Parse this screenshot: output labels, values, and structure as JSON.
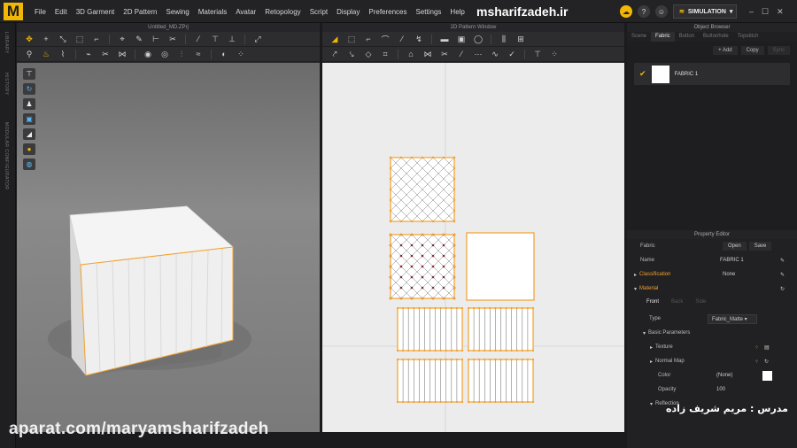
{
  "app": {
    "logo_letter": "M",
    "brand": "msharifzadeh.ir"
  },
  "menu": [
    "File",
    "Edit",
    "3D Garment",
    "2D Pattern",
    "Sewing",
    "Materials",
    "Avatar",
    "Retopology",
    "Script",
    "Display",
    "Preferences",
    "Settings",
    "Help"
  ],
  "topbar": {
    "simulation_label": "SIMULATION"
  },
  "left_strip": {
    "labels": [
      "LIBRARY",
      "HISTORY",
      "MODULAR CONFIGURATOR"
    ]
  },
  "window3d": {
    "title": "Untitled_MD.ZPrj"
  },
  "window2d": {
    "title": "2D Pattern Window"
  },
  "object_browser": {
    "title": "Object Browser",
    "tabs": [
      "Scene",
      "Fabric",
      "Button",
      "Buttonhole",
      "Topstitch"
    ],
    "active_tab": "Fabric",
    "add_label": "+ Add",
    "copy_label": "Copy",
    "sync_label": "Sync",
    "fabric_name": "FABRIC 1"
  },
  "property_editor": {
    "title": "Property Editor",
    "fabric_label": "Fabric",
    "open_label": "Open",
    "save_label": "Save",
    "name_label": "Name",
    "name_value": "FABRIC 1",
    "classification_label": "Classification",
    "classification_value": "None",
    "material_label": "Material",
    "subtabs": [
      "Front",
      "Back",
      "Side"
    ],
    "type_label": "Type",
    "type_value": "Fabric_Matte",
    "basic_params_label": "Basic Parameters",
    "texture_label": "Texture",
    "normal_map_label": "Normal Map",
    "color_label": "Color",
    "color_value": "(None)",
    "opacity_label": "Opacity",
    "opacity_value": "100",
    "reflection_label": "Reflection"
  },
  "overlay": {
    "watermark": "aparat.com/maryamsharifzadeh",
    "persian": "مدرس : مریم شریف زاده"
  },
  "colors": {
    "accent": "#f2b705",
    "outline": "#f2a02a",
    "dot_purple": "#7a2a3a"
  }
}
